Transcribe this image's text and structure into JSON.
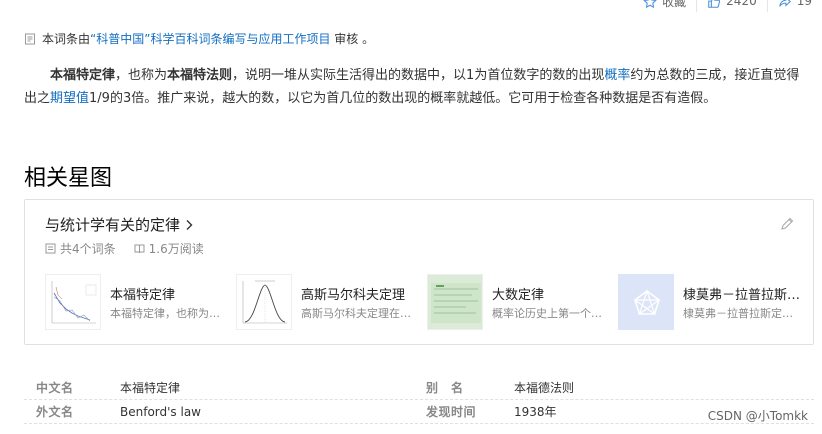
{
  "topbar": {
    "collect_label": "收藏",
    "like_count": "2420",
    "share_count": "19"
  },
  "review": {
    "prefix": "本词条由",
    "org": "“科普中国”科学百科词条编写与应用工作项目",
    "suffix": " 审核 。"
  },
  "summary": {
    "name1": "本福特定律",
    "t1": "，也称为",
    "name2": "本福特法则",
    "t2": "，说明一堆从实际生活得出的数据中，以1为首位数字的数的出现",
    "link1": "概率",
    "t3": "约为总数的三成，接近直觉得出之",
    "link2": "期望值",
    "t4": "1/9的3倍。推广来说，越大的数，以它为首几位的数出现的概率就越低。它可用于检查各种数据是否有造假。"
  },
  "section_title": "相关星图",
  "card": {
    "title": "与统计学有关的定律",
    "entry_count": "共4个词条",
    "read_count": "1.6万阅读",
    "items": [
      {
        "name": "本福特定律",
        "desc": "本福特定律，也称为本福特法则"
      },
      {
        "name": "高斯马尔科夫定理",
        "desc": "高斯马尔科夫定理在统计学中"
      },
      {
        "name": "大数定律",
        "desc": "概率论历史上第一个极限定理"
      },
      {
        "name": "棣莫弗－拉普拉斯定理",
        "desc": "棣莫弗－拉普拉斯定理是中心极限定理"
      }
    ]
  },
  "info": {
    "rows": [
      {
        "k1": "中文名",
        "v1": "本福特定律",
        "k2": "别　名",
        "v2": "本福德法则"
      },
      {
        "k1": "外文名",
        "v1": "Benford's law",
        "k2": "发现时间",
        "v2": "1938年"
      }
    ]
  },
  "watermark": "CSDN @小Tomkk",
  "colors": {
    "link": "#136ec2",
    "text": "#333333",
    "muted": "#888888"
  }
}
